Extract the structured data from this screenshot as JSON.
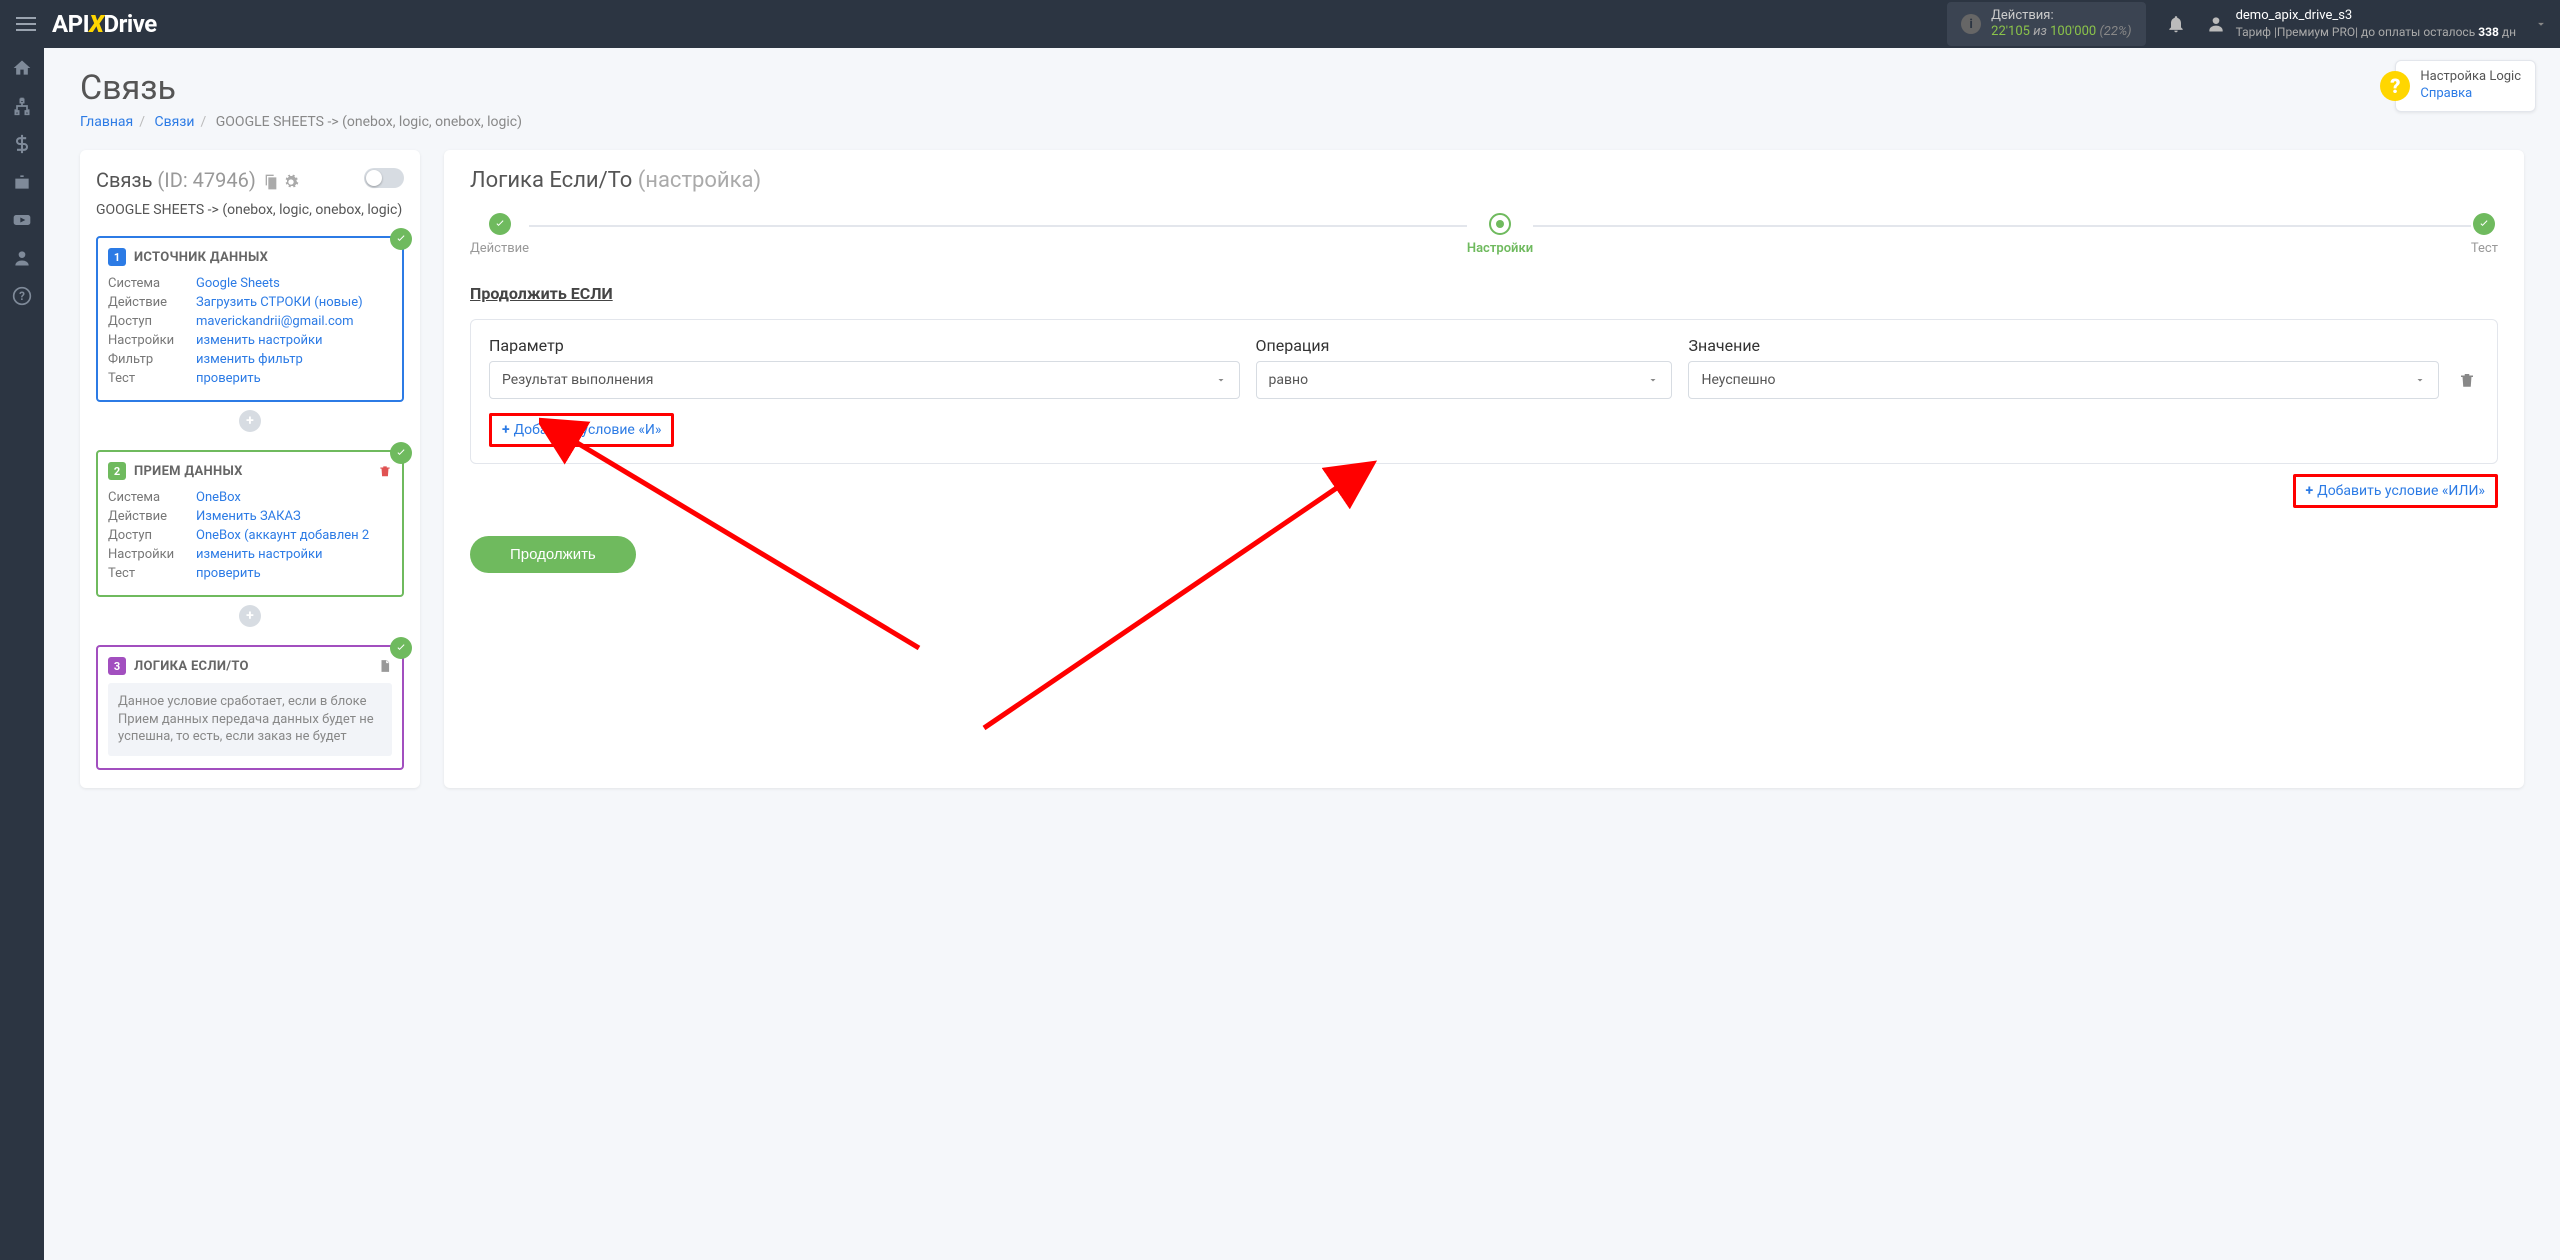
{
  "header": {
    "logo_prefix": "API",
    "logo_x": "X",
    "logo_suffix": "Drive",
    "actions_label": "Действия:",
    "actions_used": "22'105",
    "actions_mid": "из",
    "actions_total": "100'000",
    "actions_pct": "(22%)",
    "user_name": "demo_apix_drive_s3",
    "tariff_prefix": "Тариф |Премиум PRO|  до оплаты осталось ",
    "tariff_days": "338",
    "tariff_suffix": " дн"
  },
  "page": {
    "title": "Связь",
    "bc_home": "Главная",
    "bc_links": "Связи",
    "bc_current": "GOOGLE SHEETS -> (onebox, logic, onebox, logic)"
  },
  "help": {
    "line1": "Настройка Logic",
    "line2": "Справка"
  },
  "left": {
    "title": "Связь",
    "id_label": "(ID: 47946)",
    "subtitle": "GOOGLE SHEETS -> (onebox, logic, onebox, logic)",
    "card1": {
      "title": "ИСТОЧНИК ДАННЫХ",
      "k_system": "Система",
      "v_system": "Google Sheets",
      "k_action": "Действие",
      "v_action": "Загрузить СТРОКИ (новые)",
      "k_access": "Доступ",
      "v_access": "maverickandrii@gmail.com",
      "k_settings": "Настройки",
      "v_settings": "изменить настройки",
      "k_filter": "Фильтр",
      "v_filter": "изменить фильтр",
      "k_test": "Тест",
      "v_test": "проверить"
    },
    "card2": {
      "title": "ПРИЕМ ДАННЫХ",
      "k_system": "Система",
      "v_system": "OneBox",
      "k_action": "Действие",
      "v_action": "Изменить ЗАКАЗ",
      "k_access": "Доступ",
      "v_access": "OneBox (аккаунт добавлен 2",
      "k_settings": "Настройки",
      "v_settings": "изменить настройки",
      "k_test": "Тест",
      "v_test": "проверить"
    },
    "card3": {
      "title": "ЛОГИКА ЕСЛИ/ТО",
      "desc": "Данное условие сработает, если в блоке Прием данных передача данных будет не успешна, то есть, если заказ не будет"
    }
  },
  "right": {
    "title_main": "Логика Если/То ",
    "title_sub": "(настройка)",
    "step1": "Действие",
    "step2": "Настройки",
    "step3": "Тест",
    "section_h": "Продолжить ЕСЛИ",
    "col_param": "Параметр",
    "col_op": "Операция",
    "col_val": "Значение",
    "sel_param": "Результат выполнения",
    "sel_op": "равно",
    "sel_val": "Неуспешно",
    "add_and": "Добавить условие «И»",
    "add_or": "Добавить условие «ИЛИ»",
    "continue": "Продолжить"
  }
}
